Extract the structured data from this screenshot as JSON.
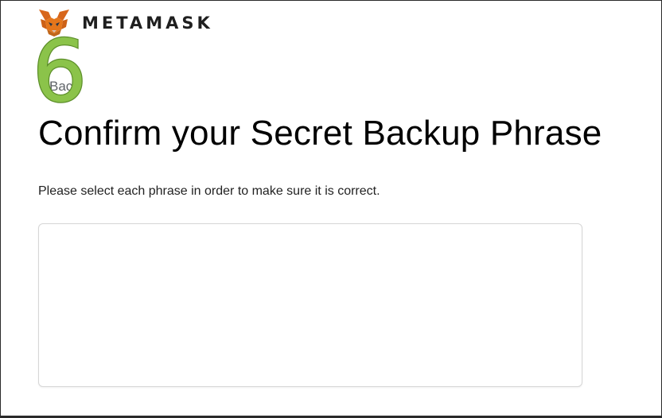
{
  "header": {
    "brand_name": "METAMASK",
    "logo_icon": "metamask-fox-icon"
  },
  "step_badge": {
    "number": "6",
    "color": "#7cb342"
  },
  "back_link": {
    "label": "Bac"
  },
  "main": {
    "title": "Confirm your Secret Backup Phrase",
    "instructions": "Please select each phrase in order to make sure it is correct."
  },
  "colors": {
    "fox_orange": "#e2761b",
    "fox_dark": "#c0661a",
    "text_primary": "#000000",
    "box_border": "#d6d6d6"
  }
}
